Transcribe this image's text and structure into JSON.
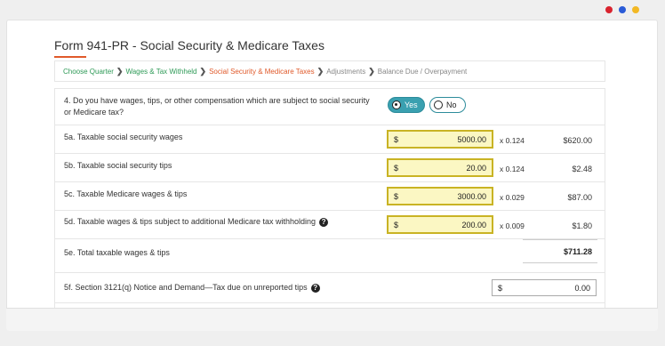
{
  "window": {
    "controls": [
      {
        "name": "red",
        "color": "#d9232e"
      },
      {
        "name": "blue",
        "color": "#2a5bd7"
      },
      {
        "name": "yellow",
        "color": "#f2b824"
      }
    ]
  },
  "page": {
    "title": "Form 941-PR - Social Security & Medicare Taxes",
    "accent_color": "#e05a2b"
  },
  "breadcrumb": [
    {
      "label": "Choose Quarter",
      "state": "done"
    },
    {
      "label": "Wages & Tax Withheld",
      "state": "done"
    },
    {
      "label": "Social Security & Medicare Taxes",
      "state": "active"
    },
    {
      "label": "Adjustments",
      "state": "future"
    },
    {
      "label": "Balance Due / Overpayment",
      "state": "future"
    }
  ],
  "q4": {
    "question": "4. Do you have wages, tips, or other compensation which are subject to social security or Medicare tax?",
    "yes_label": "Yes",
    "no_label": "No",
    "selected": "Yes"
  },
  "lines": [
    {
      "label": "5a. Taxable social security wages",
      "currency": "$",
      "value": "5000.00",
      "multiplier": "x 0.124",
      "result": "$620.00"
    },
    {
      "label": "5b. Taxable social security tips",
      "currency": "$",
      "value": "20.00",
      "multiplier": "x 0.124",
      "result": "$2.48"
    },
    {
      "label": "5c. Taxable Medicare wages & tips",
      "currency": "$",
      "value": "3000.00",
      "multiplier": "x 0.029",
      "result": "$87.00"
    },
    {
      "label": "5d. Taxable wages & tips subject to additional Medicare tax withholding",
      "currency": "$",
      "value": "200.00",
      "multiplier": "x 0.009",
      "result": "$1.80"
    }
  ],
  "total": {
    "label": "5e. Total taxable wages & tips",
    "value": "$711.28"
  },
  "line5f": {
    "label": "5f. Section 3121(q) Notice and Demand—Tax due on unreported tips",
    "currency": "$",
    "value": "0.00"
  },
  "help_glyph": "?"
}
